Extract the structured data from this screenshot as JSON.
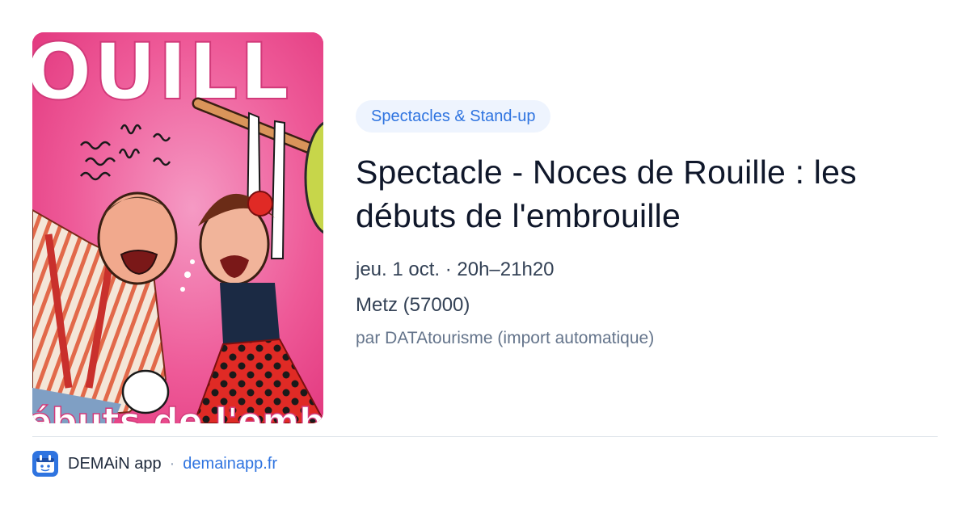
{
  "event": {
    "category": "Spectacles & Stand-up",
    "title": "Spectacle - Noces de Rouille : les débuts de l'embrouille",
    "datetime": "jeu. 1 oct. · 20h–21h20",
    "location": "Metz (57000)",
    "source": "par DATAtourisme (import automatique)",
    "image": {
      "description": "poster-illustration",
      "top_text": "OUILL",
      "bottom_text": "ébuts de l'embro"
    }
  },
  "footer": {
    "app_name": "DEMAiN app",
    "separator": "·",
    "link": "demainapp.fr"
  },
  "colors": {
    "accent": "#2f74e0",
    "chip_bg": "#eef4fe",
    "poster_pink": "#ec3f86",
    "dress_red": "#e02a25"
  }
}
